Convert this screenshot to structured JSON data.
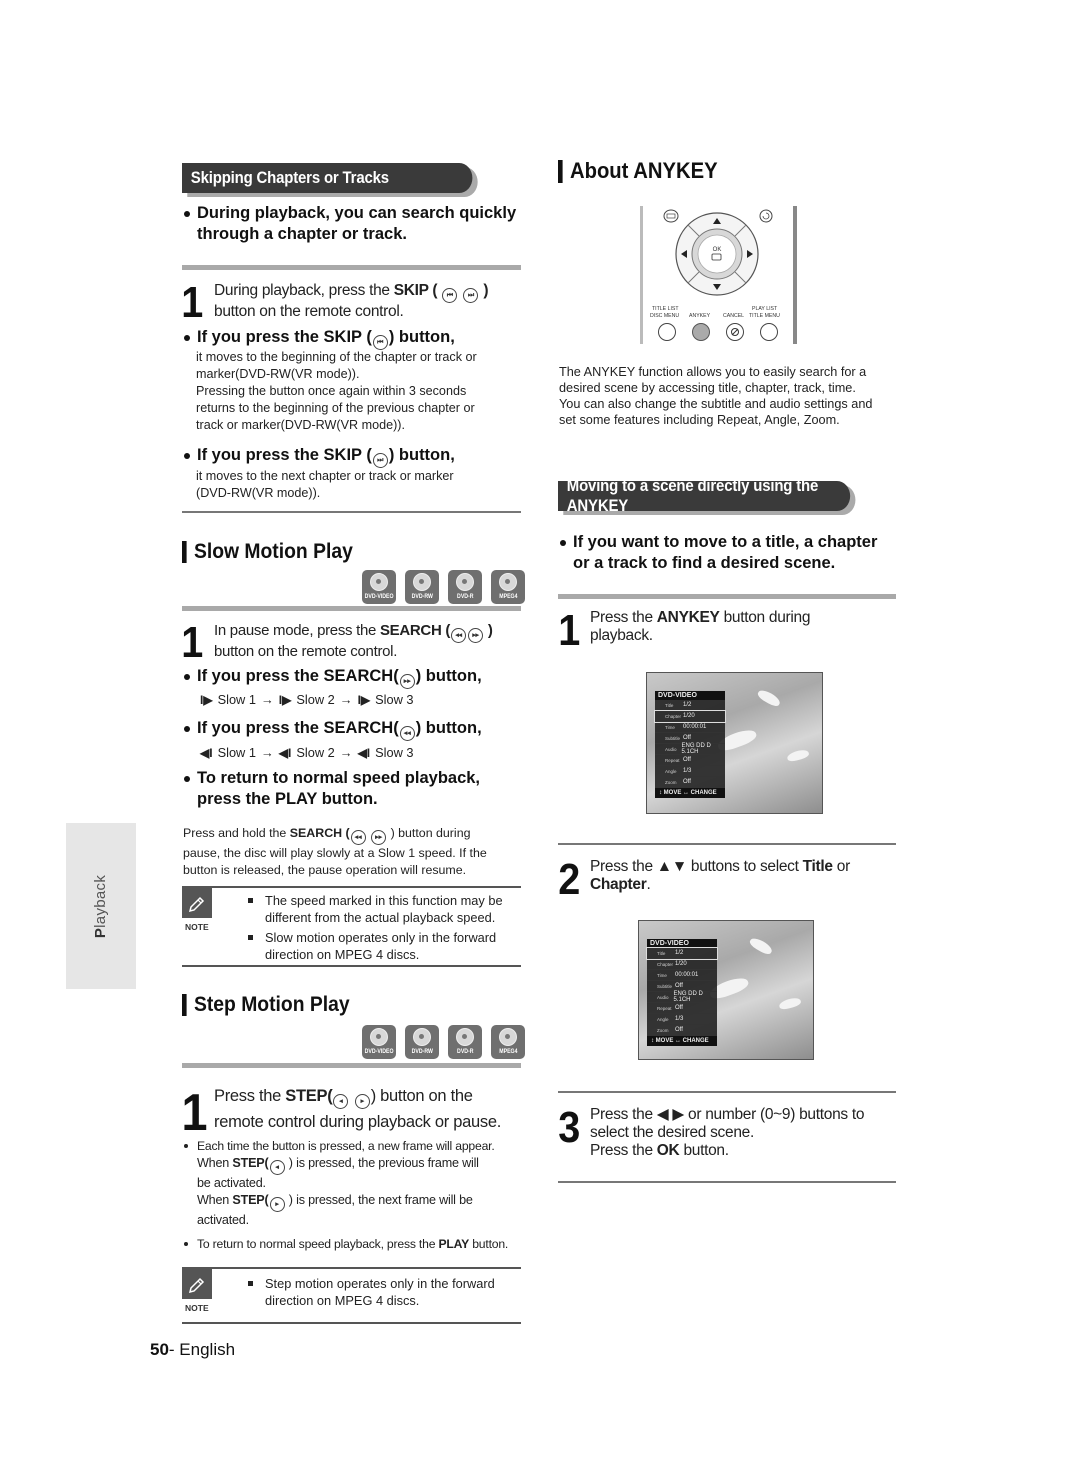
{
  "side_tab": {
    "first_letter": "P",
    "rest": "layback"
  },
  "left": {
    "skip_section": {
      "header": "Skipping Chapters or Tracks",
      "intro_bullet": "During playback, you can search quickly through a chapter or track.",
      "step1_pre": "During playback, press the ",
      "step1_bold": "SKIP (",
      "step1_close": " )",
      "step1_line2": "button on the remote control.",
      "step1_num": "1",
      "b1_head_pre": "If you press the SKIP (",
      "b1_head_post": ")  button,",
      "b1_body": [
        "it moves to the beginning of the chapter or track or",
        "marker(DVD-RW(VR mode)).",
        "Pressing the button once again within 3 seconds",
        "returns to the beginning of the previous chapter or",
        "track or marker(DVD-RW(VR mode))."
      ],
      "b2_head_pre": "If you press the SKIP (",
      "b2_head_post": ")  button,",
      "b2_body": [
        "it moves to the next chapter or track or marker",
        "(DVD-RW(VR mode))."
      ]
    },
    "slow_section": {
      "title": "Slow Motion Play",
      "discs": [
        "DVD-VIDEO",
        "DVD-RW",
        "DVD-R",
        "MPEG4"
      ],
      "step1_num": "1",
      "step1_pre": "In pause mode, press the ",
      "step1_bold": "SEARCH (",
      "step1_close": " )",
      "step1_line2": "button on the remote control.",
      "fwd_head_pre": "If you press the SEARCH(",
      "fwd_head_post": ") button,",
      "fwd_seq": [
        "Slow 1",
        "Slow 2",
        "Slow 3"
      ],
      "rev_head_pre": "If you press the SEARCH(",
      "rev_head_post": ")  button,",
      "rev_seq": [
        "Slow 1",
        "Slow 2",
        "Slow 3"
      ],
      "return_head": [
        "To return to normal speed playback,",
        "press the PLAY button."
      ],
      "hold_pre": "Press and hold the ",
      "hold_bold": "SEARCH (",
      "hold_post": " ) button during",
      "hold_lines": [
        "pause, the disc will play slowly at a Slow 1 speed. If the",
        "button is released, the pause operation will resume."
      ],
      "note_label": "NOTE",
      "notes": [
        [
          "The speed marked in this function may be",
          "different from the actual playback speed."
        ],
        [
          "Slow motion operates only in the forward",
          "direction on MPEG 4 discs."
        ]
      ]
    },
    "step_section": {
      "title": "Step Motion Play",
      "discs": [
        "DVD-VIDEO",
        "DVD-RW",
        "DVD-R",
        "MPEG4"
      ],
      "step1_num": "1",
      "step1_pre": "Press the ",
      "step1_bold": "STEP(",
      "step1_post": ") button on the",
      "step1_line2": "remote control during playback or pause.",
      "dot1_lines": [
        "Each time the button is pressed, a new frame will appear."
      ],
      "when1_pre": "When ",
      "when1_bold": "STEP(",
      "when1_post": " )  is pressed, the previous frame will",
      "when1_line2": "be activated.",
      "when2_pre": "When ",
      "when2_bold": "STEP(",
      "when2_post": " ) is pressed, the next frame will be",
      "when2_line2": "activated.",
      "dot2_pre": "To return to normal speed playback, press the ",
      "dot2_bold": "PLAY",
      "dot2_post": " button.",
      "note_label": "NOTE",
      "notes": [
        [
          "Step motion operates only in the forward",
          "direction on MPEG 4 discs."
        ]
      ]
    }
  },
  "right": {
    "title": "About ANYKEY",
    "remote": {
      "ok": "OK",
      "labels_top": [
        "TITLE LIST",
        "PLAY LIST"
      ],
      "labels_bottom": [
        "DISC MENU",
        "ANYKEY",
        "CANCEL",
        "TITLE MENU"
      ]
    },
    "intro": [
      "The ANYKEY function allows you to easily search for a",
      "desired scene by accessing title, chapter, track, time.",
      "You can also change the subtitle and audio settings and",
      "set some features including Repeat, Angle, Zoom."
    ],
    "section_header": "Moving to a scene directly using the ANYKEY",
    "bullet": [
      "If you want to move to a title, a chapter",
      "or a track to find a desired scene."
    ],
    "step1_num": "1",
    "step1_pre": "Press the ",
    "step1_bold": "ANYKEY",
    "step1_post": " button during",
    "step1_line2": "playback.",
    "step2_num": "2",
    "step2_pre": "Press the ▲▼ buttons to select ",
    "step2_bold1": "Title",
    "step2_mid": " or",
    "step2_bold2": "Chapter",
    "step2_end": ".",
    "step3_num": "3",
    "step3_line1": "Press the ◀ ▶ or number (0~9) buttons to",
    "step3_line2": "select the desired scene.",
    "step3_pre3": "Press the ",
    "step3_bold3": "OK",
    "step3_post3": " button.",
    "osd": {
      "header": "DVD-VIDEO",
      "rows": [
        {
          "key": "Title",
          "value": "1/2"
        },
        {
          "key": "Chapter",
          "value": "1/20"
        },
        {
          "key": "Time",
          "value": "00:00:01"
        },
        {
          "key": "Subtitle",
          "value": "Off"
        },
        {
          "key": "Audio",
          "value": "ENG DD D 5.1CH"
        },
        {
          "key": "Repeat",
          "value": "Off"
        },
        {
          "key": "Angle",
          "value": "1/3"
        },
        {
          "key": "Zoom",
          "value": "Off"
        }
      ],
      "footer": "↕ MOVE   ↔ CHANGE",
      "selected_row_screen1": "Chapter",
      "selected_row_screen2": "Title"
    }
  },
  "footer": {
    "page_number": "50",
    "suffix": "- English"
  }
}
